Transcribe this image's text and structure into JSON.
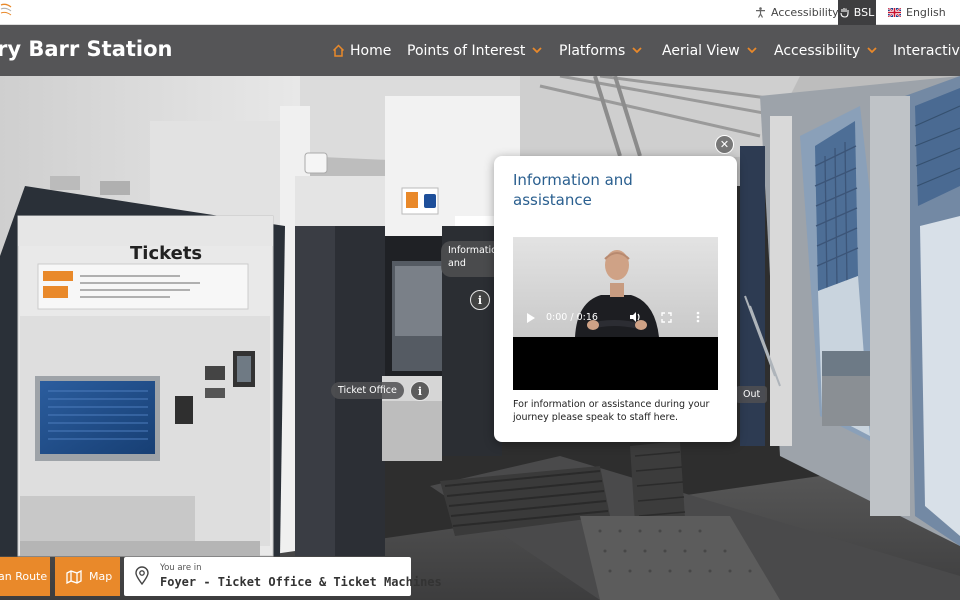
{
  "topbar": {
    "accessibility_label": "Accessibility",
    "bsl_label": "BSL",
    "language_label": "English"
  },
  "nav": {
    "site_title": "ry Barr Station",
    "items": [
      {
        "label": "Home"
      },
      {
        "label": "Points of Interest"
      },
      {
        "label": "Platforms"
      },
      {
        "label": "Aerial View"
      },
      {
        "label": "Accessibility"
      },
      {
        "label": "Interactive"
      }
    ]
  },
  "scene": {
    "ticket_machine_label": "Tickets",
    "hotspots": {
      "info_label": "Information and assistance",
      "ticket_office_label": "Ticket Office",
      "exit_label": "Out"
    }
  },
  "popup": {
    "title": "Information and assistance",
    "video_time": "0:00 / 0:16",
    "progress": 0,
    "body": "For information or assistance during your journey please speak to staff here."
  },
  "bottom": {
    "route_label": "an Route",
    "map_label": "Map",
    "location_prefix": "You are in",
    "location_name": "Foyer - Ticket Office & Ticket Machines"
  },
  "colors": {
    "accent_orange": "#e9892a",
    "nav_bg": "#555557",
    "title_blue": "#2a5f8f"
  }
}
